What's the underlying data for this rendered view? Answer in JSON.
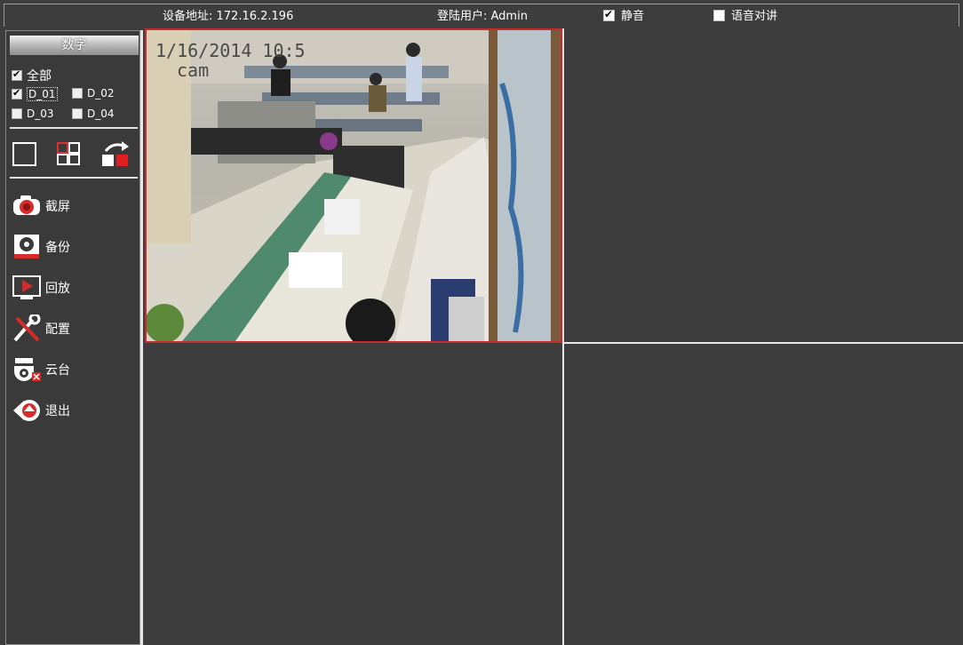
{
  "topbar": {
    "device_address": "设备地址: 172.16.2.196",
    "login_user": "登陆用户: Admin",
    "mute_label": "静音",
    "mute_checked": true,
    "intercom_label": "语音对讲",
    "intercom_checked": false
  },
  "sidebar": {
    "group_title": "数字",
    "all_label": "全部",
    "channels": [
      {
        "label": "D_01",
        "checked": true
      },
      {
        "label": "D_02",
        "checked": false
      },
      {
        "label": "D_03",
        "checked": false
      },
      {
        "label": "D_04",
        "checked": false
      }
    ],
    "menu": [
      {
        "label": "截屏",
        "icon": "camera-icon"
      },
      {
        "label": "备份",
        "icon": "backup-disk-icon"
      },
      {
        "label": "回放",
        "icon": "playback-monitor-icon"
      },
      {
        "label": "配置",
        "icon": "wrench-screwdriver-icon"
      },
      {
        "label": "云台",
        "icon": "ptz-camera-icon"
      },
      {
        "label": "退出",
        "icon": "exit-icon"
      }
    ]
  },
  "video": {
    "cam1_osd_datetime": "1/16/2014 10:5",
    "cam1_osd_name": "cam",
    "selected_border_color": "#c92a2a"
  }
}
